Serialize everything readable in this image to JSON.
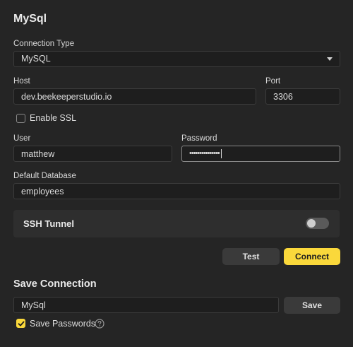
{
  "form": {
    "title": "MySql",
    "connection_type": {
      "label": "Connection Type",
      "value": "MySQL"
    },
    "host": {
      "label": "Host",
      "value": "dev.beekeeperstudio.io"
    },
    "port": {
      "label": "Port",
      "value": "3306"
    },
    "enable_ssl": {
      "label": "Enable SSL",
      "checked": false
    },
    "user": {
      "label": "User",
      "value": "matthew"
    },
    "password": {
      "label": "Password",
      "value": "•••••••••••••••"
    },
    "default_database": {
      "label": "Default Database",
      "value": "employees"
    },
    "ssh_tunnel": {
      "label": "SSH Tunnel",
      "enabled": false
    },
    "buttons": {
      "test_label": "Test",
      "connect_label": "Connect"
    }
  },
  "save_connection": {
    "title": "Save Connection",
    "name_value": "MySql",
    "save_label": "Save",
    "save_passwords": {
      "label": "Save Passwords",
      "checked": true
    }
  },
  "colors": {
    "background": "#252525",
    "accent": "#fad83b",
    "panel": "#2e2e2e",
    "input_bg": "#1e1e1e"
  },
  "icons": {
    "dropdown": "chevron-down-icon",
    "checkmark": "checkmark-icon",
    "help": "question-circle-icon"
  }
}
